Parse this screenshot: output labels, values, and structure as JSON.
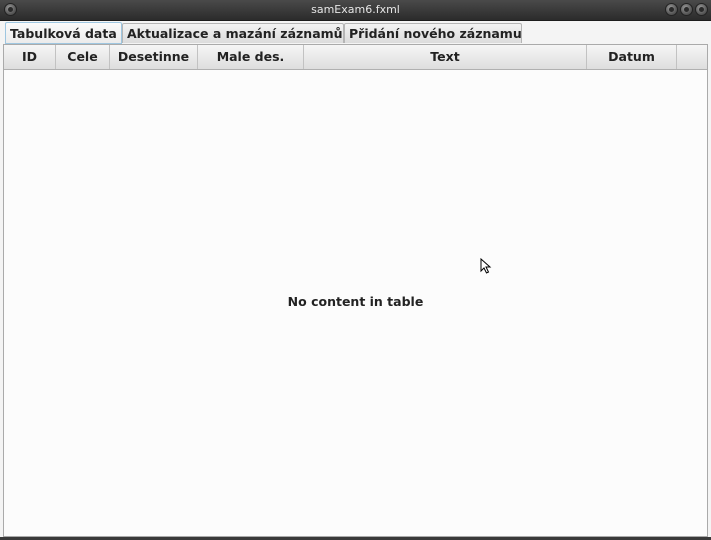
{
  "window": {
    "title": "samExam6.fxml"
  },
  "tabs": [
    {
      "label": "Tabulková data",
      "selected": true
    },
    {
      "label": "Aktualizace a mazání záznamů",
      "selected": false
    },
    {
      "label": "Přidání nového záznamu",
      "selected": false
    }
  ],
  "table": {
    "columns": [
      "ID",
      "Cele",
      "Desetinne",
      "Male des.",
      "Text",
      "Datum"
    ],
    "placeholder": "No content in table"
  },
  "colors": {
    "selected_tab_border": "#9ec6e0",
    "titlebar": "#333333"
  }
}
